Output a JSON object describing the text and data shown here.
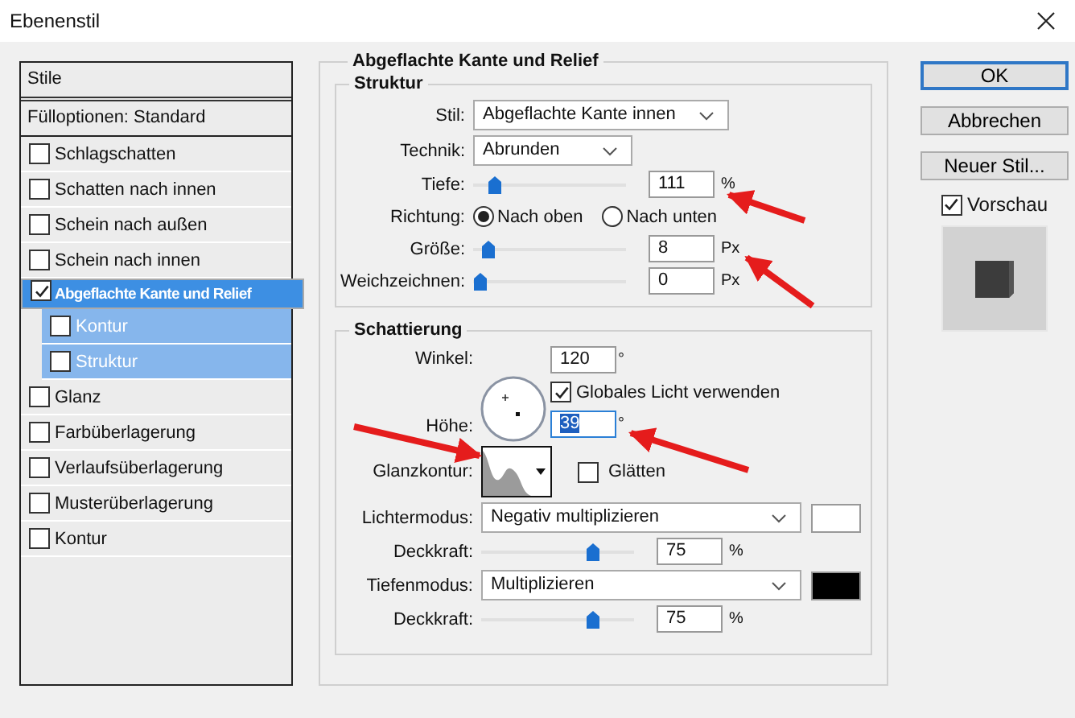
{
  "window": {
    "title": "Ebenenstil"
  },
  "styles_panel": {
    "header": "Stile",
    "blending_options": "Fülloptionen: Standard",
    "items": [
      {
        "label": "Schlagschatten",
        "checked": false,
        "selected": false
      },
      {
        "label": "Schatten nach innen",
        "checked": false,
        "selected": false
      },
      {
        "label": "Schein nach außen",
        "checked": false,
        "selected": false
      },
      {
        "label": "Schein nach innen",
        "checked": false,
        "selected": false
      },
      {
        "label": "Abgeflachte Kante und Relief",
        "checked": true,
        "selected": true,
        "children": [
          {
            "label": "Kontur",
            "checked": false,
            "selected": false
          },
          {
            "label": "Struktur",
            "checked": false,
            "selected": false
          }
        ]
      },
      {
        "label": "Glanz",
        "checked": false,
        "selected": false
      },
      {
        "label": "Farbüberlagerung",
        "checked": false,
        "selected": false
      },
      {
        "label": "Verlaufsüberlagerung",
        "checked": false,
        "selected": false
      },
      {
        "label": "Musterüberlagerung",
        "checked": false,
        "selected": false
      },
      {
        "label": "Kontur",
        "checked": false,
        "selected": false
      }
    ]
  },
  "bevel": {
    "title": "Abgeflachte Kante und Relief",
    "structure": {
      "title": "Struktur",
      "rows": [
        {
          "kind": "select",
          "label": "Stil:",
          "value": "Abgeflachte Kante innen"
        },
        {
          "kind": "select",
          "label": "Technik:",
          "value": "Abrunden"
        },
        {
          "kind": "slider",
          "label": "Tiefe:",
          "level": 0.1,
          "value": "111",
          "unit": "%"
        },
        {
          "kind": "radio",
          "label": "Richtung:",
          "options": [
            {
              "label": "Nach oben",
              "selected": true
            },
            {
              "label": "Nach unten",
              "selected": false
            }
          ]
        },
        {
          "kind": "slider",
          "label": "Größe:",
          "level": 0.06,
          "value": "8",
          "unit": "Px"
        },
        {
          "kind": "slider",
          "label": "Weichzeichnen:",
          "level": 0,
          "value": "0",
          "unit": "Px"
        }
      ]
    },
    "shading": {
      "title": "Schattierung",
      "angle": {
        "label": "Winkel:",
        "value": "120",
        "unit": "°"
      },
      "global_light": {
        "label": "Globales Licht verwenden",
        "checked": true
      },
      "altitude": {
        "label": "Höhe:",
        "value": "39",
        "unit": "°",
        "selected": true
      },
      "gloss_contour": {
        "label": "Glanzkontur:"
      },
      "anti_aliased": {
        "label": "Glätten",
        "checked": false
      },
      "rows": [
        {
          "kind": "select",
          "label": "Lichtermodus:",
          "value": "Negativ multiplizieren",
          "color": "#ffffff"
        },
        {
          "kind": "slider",
          "label": "Deckkraft:",
          "level": 0.75,
          "value": "75",
          "unit": "%"
        },
        {
          "kind": "select",
          "label": "Tiefenmodus:",
          "value": "Multiplizieren",
          "color": "#000000"
        },
        {
          "kind": "slider",
          "label": "Deckkraft:",
          "level": 0.75,
          "value": "75",
          "unit": "%"
        }
      ]
    }
  },
  "buttons": [
    {
      "label": "OK",
      "default": true
    },
    {
      "label": "Abbrechen",
      "default": false
    },
    {
      "label": "Neuer Stil...",
      "default": false
    }
  ],
  "preview": {
    "label": "Vorschau",
    "checked": true
  }
}
